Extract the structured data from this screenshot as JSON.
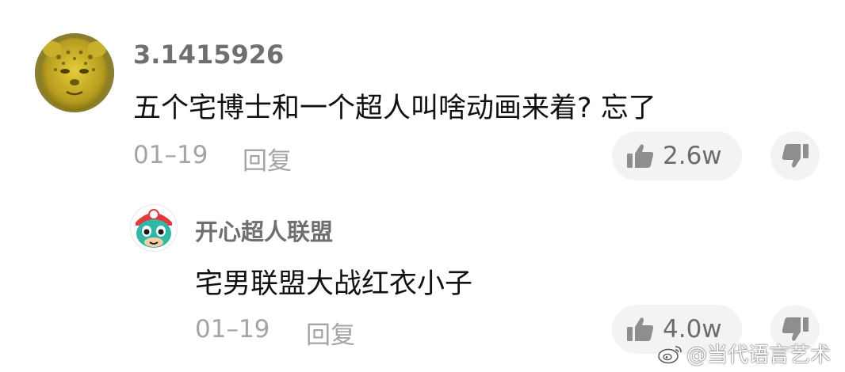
{
  "colors": {
    "background": "#ffffff",
    "username": "#6f6f6f",
    "comment_text": "#111111",
    "meta_text": "#a4a4a4",
    "pill_background": "#f3f3f3"
  },
  "comment": {
    "username": "3.1415926",
    "text": "五个宅博士和一个超人叫啥动画来着? 忘了",
    "date": "01–19",
    "reply_label": "回复",
    "like_count": "2.6w",
    "avatar_icon": "yellow-leopard-face-avatar"
  },
  "reply": {
    "username": "开心超人联盟",
    "text": "宅男联盟大战红衣小子",
    "date": "01–19",
    "reply_label": "回复",
    "like_count": "4.0w",
    "avatar_icon": "cartoon-superhero-avatar"
  },
  "icons": {
    "like": "thumbs-up-icon",
    "dislike": "thumbs-down-icon",
    "watermark": "weibo-logo-icon"
  },
  "watermark": {
    "text": "@当代语言艺术"
  }
}
